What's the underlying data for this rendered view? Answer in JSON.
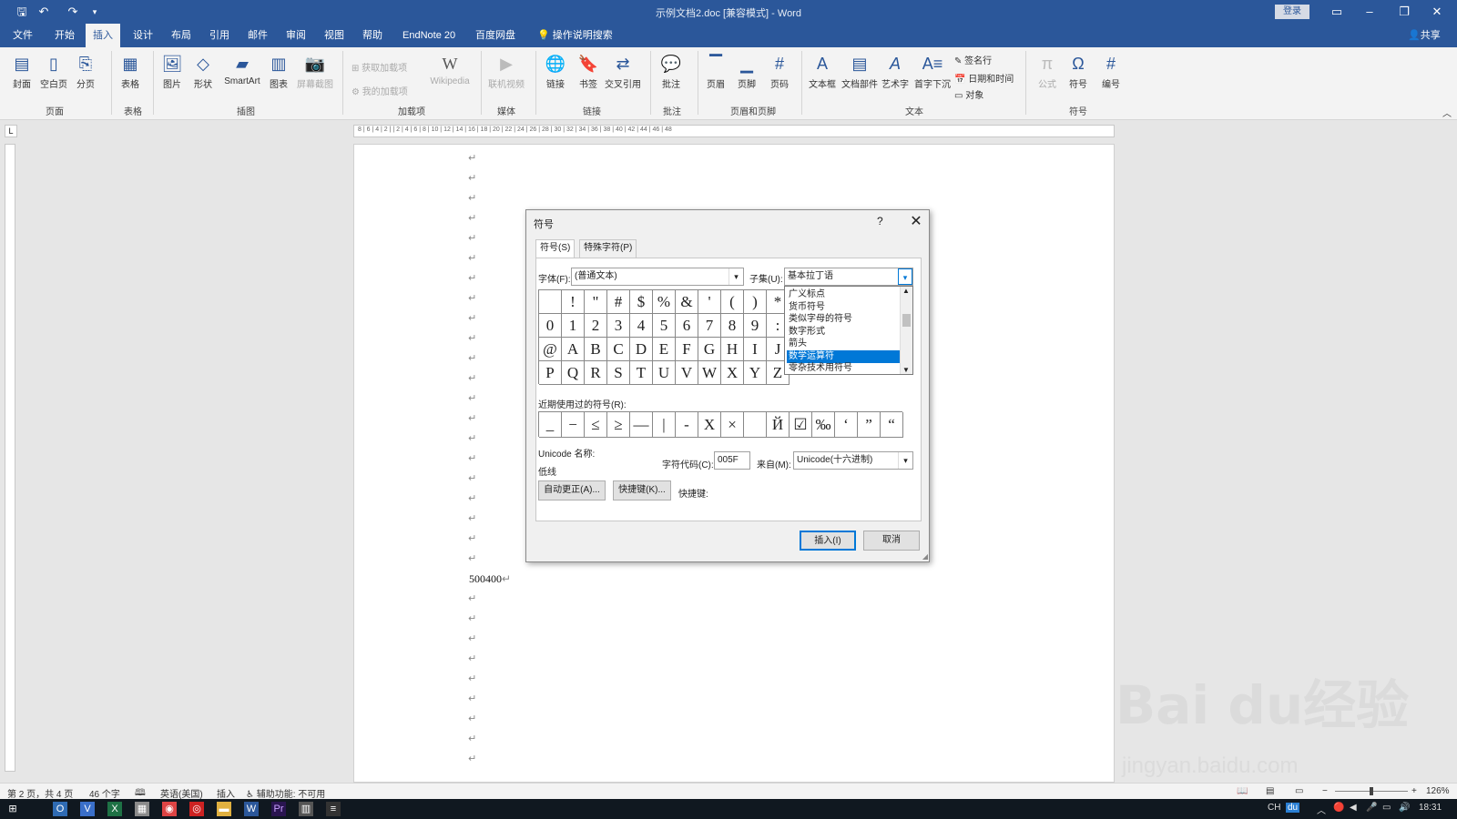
{
  "window": {
    "title": "示例文档2.doc [兼容模式] - Word",
    "login": "登录",
    "share": "共享"
  },
  "menu": {
    "tabs": [
      "文件",
      "开始",
      "插入",
      "设计",
      "布局",
      "引用",
      "邮件",
      "审阅",
      "视图",
      "帮助",
      "EndNote 20",
      "百度网盘"
    ],
    "active": "插入",
    "tell_me": "操作说明搜索"
  },
  "ribbon": {
    "buttons": [
      "封面",
      "空白页",
      "分页",
      "表格",
      "图片",
      "形状",
      "SmartArt",
      "图表",
      "屏幕截图",
      "Wikipedia",
      "联机视频",
      "链接",
      "书签",
      "交叉引用",
      "批注",
      "页眉",
      "页脚",
      "页码",
      "文本框",
      "文档部件",
      "艺术字",
      "首字下沉",
      "公式",
      "符号",
      "编号"
    ],
    "small": [
      "获取加载项",
      "我的加载项",
      "签名行",
      "日期和时间",
      "对象"
    ],
    "groups": [
      "页面",
      "表格",
      "插图",
      "加载项",
      "媒体",
      "链接",
      "批注",
      "页眉和页脚",
      "文本",
      "符号"
    ]
  },
  "ruler": {
    "h": "8 | 6 | 4 | 2 | | 2 | 4 | 6 | 8 | 10 | 12 | 14 | 16 | 18 | 20 | 22 | 24 | 26 | 28 | 30 | 32 | 34 | 36 | 38 | 40 | 42 | 44 | 46 | 48"
  },
  "doc": {
    "text": "500400",
    "para_mark": "↵"
  },
  "dialog": {
    "title": "符号",
    "help": "?",
    "close": "✕",
    "tabs": [
      "符号(S)",
      "特殊字符(P)"
    ],
    "font_label": "字体(F):",
    "font_value": "(普通文本)",
    "subset_label": "子集(U):",
    "subset_value": "基本拉丁语",
    "subset_options": [
      "广义标点",
      "货币符号",
      "类似字母的符号",
      "数字形式",
      "箭头",
      "数学运算符",
      "零杂技术用符号"
    ],
    "subset_selected": "数学运算符",
    "grid": [
      [
        " ",
        "!",
        "\"",
        "#",
        "$",
        "%",
        "&",
        "'",
        "(",
        ")",
        "*"
      ],
      [
        "0",
        "1",
        "2",
        "3",
        "4",
        "5",
        "6",
        "7",
        "8",
        "9",
        ":"
      ],
      [
        "@",
        "A",
        "B",
        "C",
        "D",
        "E",
        "F",
        "G",
        "H",
        "I",
        "J"
      ],
      [
        "P",
        "Q",
        "R",
        "S",
        "T",
        "U",
        "V",
        "W",
        "X",
        "Y",
        "Z"
      ]
    ],
    "recent_label": "近期使用过的符号(R):",
    "recent": [
      "_",
      "−",
      "≤",
      "≥",
      "—",
      "|",
      "-",
      "X",
      "×",
      " ",
      "Й",
      "☑",
      "‰",
      "‘",
      "”",
      "“"
    ],
    "unicode_name_label": "Unicode 名称:",
    "unicode_name": "低线",
    "charcode_label": "字符代码(C):",
    "charcode": "005F",
    "from_label": "来自(M):",
    "from_value": "Unicode(十六进制)",
    "autocorrect": "自动更正(A)...",
    "shortcut_key": "快捷键(K)...",
    "shortcut_label": "快捷键:",
    "insert": "插入(I)",
    "cancel": "取消"
  },
  "status": {
    "page": "第 2 页，共 4 页",
    "words": "46 个字",
    "lang": "英语(美国)",
    "mode": "插入",
    "access": "辅助功能: 不可用",
    "zoom": "126%"
  },
  "taskbar": {
    "time": "18:31",
    "ime": "CH"
  },
  "watermark": {
    "brand": "Bai du经验",
    "url": "jingyan.baidu.com"
  }
}
